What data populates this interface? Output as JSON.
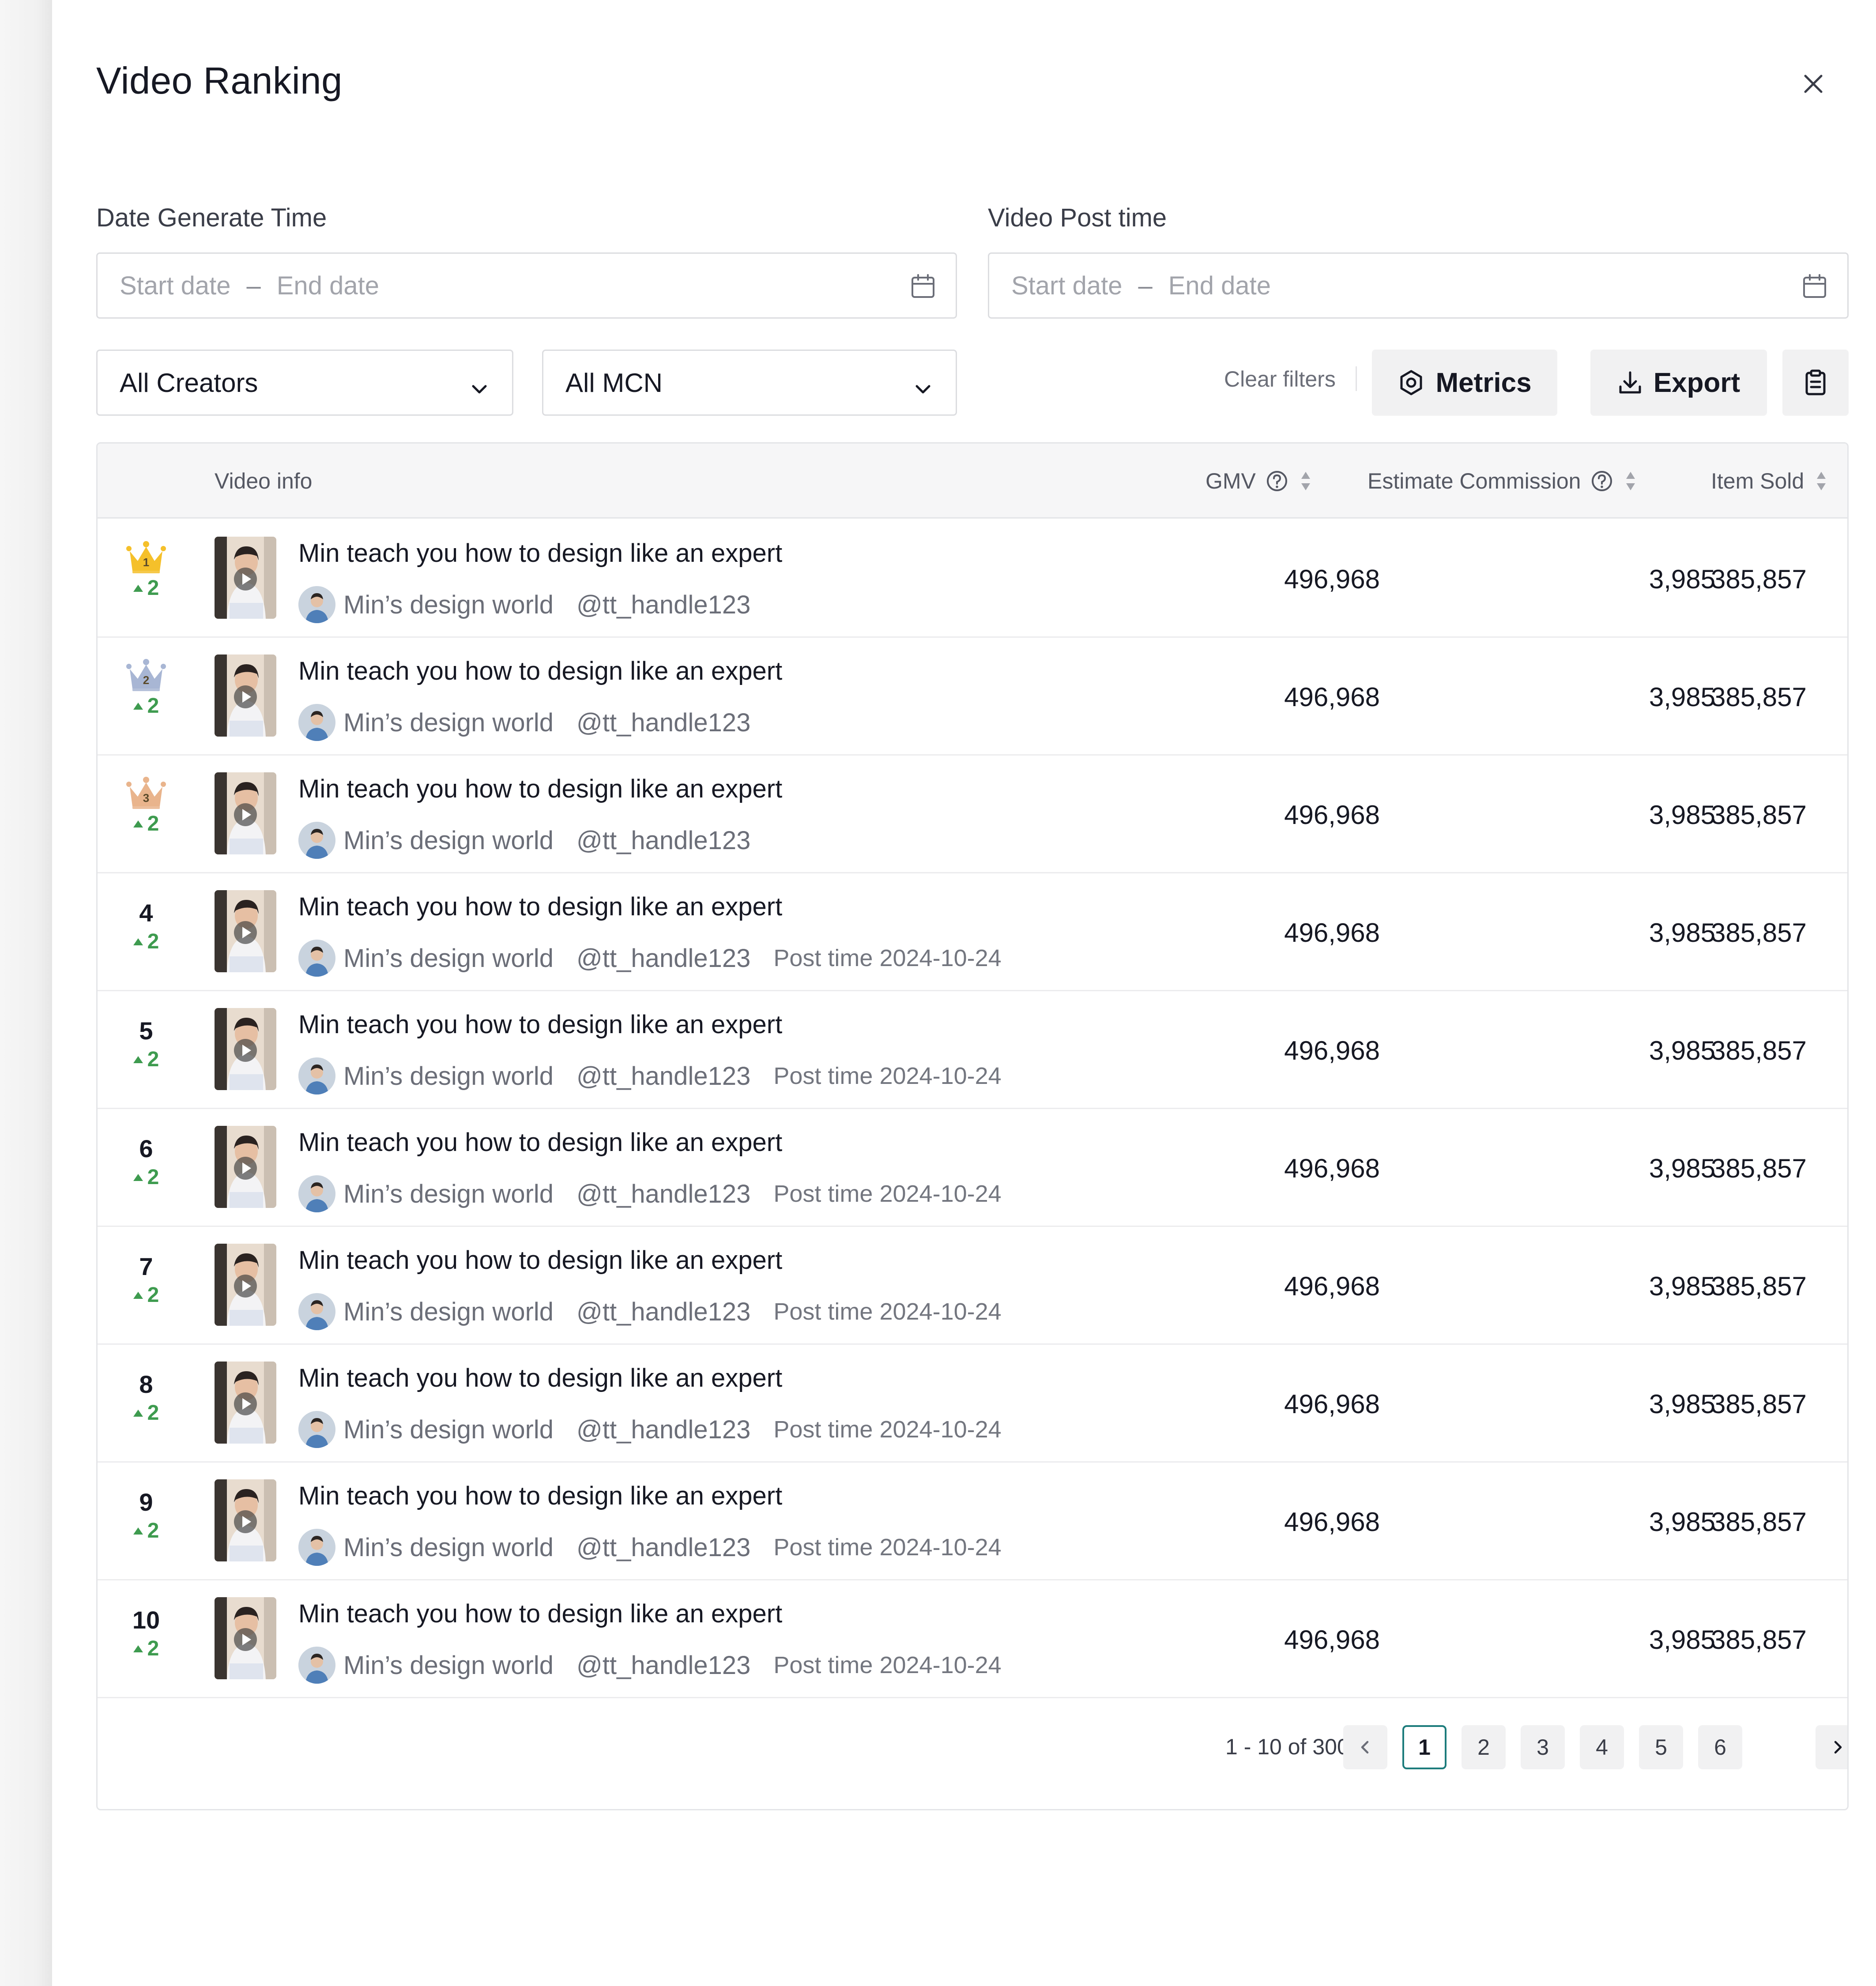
{
  "title": "Video Ranking",
  "filters": {
    "date_generate_label": "Date Generate Time",
    "video_post_label": "Video Post time",
    "start_placeholder": "Start date",
    "end_placeholder": "End date",
    "dash": "–",
    "creators": "All Creators",
    "mcn": "All MCN",
    "clear": "Clear filters",
    "metrics": "Metrics",
    "export": "Export"
  },
  "table": {
    "headers": {
      "video_info": "Video info",
      "gmv": "GMV",
      "commission": "Estimate Commission",
      "item_sold": "Item Sold"
    },
    "rows": [
      {
        "rank": "1",
        "change": "2",
        "title": "Min teach you how to design like an expert",
        "creator": "Min’s design world",
        "handle": "@tt_handle123",
        "post_label": "",
        "post_date": "",
        "gmv": "496,968",
        "commission": "3,985",
        "sold": "385,857"
      },
      {
        "rank": "2",
        "change": "2",
        "title": "Min teach you how to design like an expert",
        "creator": "Min’s design world",
        "handle": "@tt_handle123",
        "post_label": "",
        "post_date": "",
        "gmv": "496,968",
        "commission": "3,985",
        "sold": "385,857"
      },
      {
        "rank": "3",
        "change": "2",
        "title": "Min teach you how to design like an expert",
        "creator": "Min’s design world",
        "handle": "@tt_handle123",
        "post_label": "",
        "post_date": "",
        "gmv": "496,968",
        "commission": "3,985",
        "sold": "385,857"
      },
      {
        "rank": "4",
        "change": "2",
        "title": "Min teach you how to design like an expert",
        "creator": "Min’s design world",
        "handle": "@tt_handle123",
        "post_label": "Post time",
        "post_date": "2024-10-24",
        "gmv": "496,968",
        "commission": "3,985",
        "sold": "385,857"
      },
      {
        "rank": "5",
        "change": "2",
        "title": "Min teach you how to design like an expert",
        "creator": "Min’s design world",
        "handle": "@tt_handle123",
        "post_label": "Post time",
        "post_date": "2024-10-24",
        "gmv": "496,968",
        "commission": "3,985",
        "sold": "385,857"
      },
      {
        "rank": "6",
        "change": "2",
        "title": "Min teach you how to design like an expert",
        "creator": "Min’s design world",
        "handle": "@tt_handle123",
        "post_label": "Post time",
        "post_date": "2024-10-24",
        "gmv": "496,968",
        "commission": "3,985",
        "sold": "385,857"
      },
      {
        "rank": "7",
        "change": "2",
        "title": "Min teach you how to design like an expert",
        "creator": "Min’s design world",
        "handle": "@tt_handle123",
        "post_label": "Post time",
        "post_date": "2024-10-24",
        "gmv": "496,968",
        "commission": "3,985",
        "sold": "385,857"
      },
      {
        "rank": "8",
        "change": "2",
        "title": "Min teach you how to design like an expert",
        "creator": "Min’s design world",
        "handle": "@tt_handle123",
        "post_label": "Post time",
        "post_date": "2024-10-24",
        "gmv": "496,968",
        "commission": "3,985",
        "sold": "385,857"
      },
      {
        "rank": "9",
        "change": "2",
        "title": "Min teach you how to design like an expert",
        "creator": "Min’s design world",
        "handle": "@tt_handle123",
        "post_label": "Post time",
        "post_date": "2024-10-24",
        "gmv": "496,968",
        "commission": "3,985",
        "sold": "385,857"
      },
      {
        "rank": "10",
        "change": "2",
        "title": "Min teach you how to design like an expert",
        "creator": "Min’s design world",
        "handle": "@tt_handle123",
        "post_label": "Post time",
        "post_date": "2024-10-24",
        "gmv": "496,968",
        "commission": "3,985",
        "sold": "385,857"
      }
    ]
  },
  "pagination": {
    "info": "1 - 10 of 300",
    "pages": [
      "1",
      "2",
      "3",
      "4",
      "5",
      "6"
    ],
    "current": "1"
  },
  "colors": {
    "crown_gold": "#f5c02a",
    "crown_silver": "#a8b6d4",
    "crown_bronze": "#e9b48c",
    "rank_up_green": "#3e9b4f",
    "active_page_border": "#1d7c7c"
  }
}
